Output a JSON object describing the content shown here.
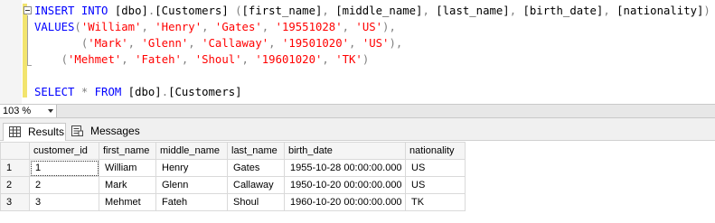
{
  "editor": {
    "lines": [
      {
        "tokens": [
          {
            "t": "INSERT",
            "c": "kw"
          },
          {
            "t": " ",
            "c": "ident"
          },
          {
            "t": "INTO",
            "c": "kw"
          },
          {
            "t": " [dbo]",
            "c": "ident"
          },
          {
            "t": ".",
            "c": "pun"
          },
          {
            "t": "[Customers]",
            "c": "ident"
          },
          {
            "t": " ",
            "c": "ident"
          },
          {
            "t": "(",
            "c": "pun"
          },
          {
            "t": "[first_name]",
            "c": "ident"
          },
          {
            "t": ", ",
            "c": "pun"
          },
          {
            "t": "[middle_name]",
            "c": "ident"
          },
          {
            "t": ", ",
            "c": "pun"
          },
          {
            "t": "[last_name]",
            "c": "ident"
          },
          {
            "t": ", ",
            "c": "pun"
          },
          {
            "t": "[birth_date]",
            "c": "ident"
          },
          {
            "t": ", ",
            "c": "pun"
          },
          {
            "t": "[nationality]",
            "c": "ident"
          },
          {
            "t": ")",
            "c": "pun"
          }
        ]
      },
      {
        "tokens": [
          {
            "t": "VALUES",
            "c": "kw"
          },
          {
            "t": "(",
            "c": "pun"
          },
          {
            "t": "'William'",
            "c": "str"
          },
          {
            "t": ", ",
            "c": "pun"
          },
          {
            "t": "'Henry'",
            "c": "str"
          },
          {
            "t": ", ",
            "c": "pun"
          },
          {
            "t": "'Gates'",
            "c": "str"
          },
          {
            "t": ", ",
            "c": "pun"
          },
          {
            "t": "'19551028'",
            "c": "str"
          },
          {
            "t": ", ",
            "c": "pun"
          },
          {
            "t": "'US'",
            "c": "str"
          },
          {
            "t": "),",
            "c": "pun"
          }
        ]
      },
      {
        "tokens": [
          {
            "t": "       ",
            "c": "ident"
          },
          {
            "t": "(",
            "c": "pun"
          },
          {
            "t": "'Mark'",
            "c": "str"
          },
          {
            "t": ", ",
            "c": "pun"
          },
          {
            "t": "'Glenn'",
            "c": "str"
          },
          {
            "t": ", ",
            "c": "pun"
          },
          {
            "t": "'Callaway'",
            "c": "str"
          },
          {
            "t": ", ",
            "c": "pun"
          },
          {
            "t": "'19501020'",
            "c": "str"
          },
          {
            "t": ", ",
            "c": "pun"
          },
          {
            "t": "'US'",
            "c": "str"
          },
          {
            "t": "),",
            "c": "pun"
          }
        ]
      },
      {
        "tokens": [
          {
            "t": "    ",
            "c": "ident"
          },
          {
            "t": "(",
            "c": "pun"
          },
          {
            "t": "'Mehmet'",
            "c": "str"
          },
          {
            "t": ", ",
            "c": "pun"
          },
          {
            "t": "'Fateh'",
            "c": "str"
          },
          {
            "t": ", ",
            "c": "pun"
          },
          {
            "t": "'Shoul'",
            "c": "str"
          },
          {
            "t": ", ",
            "c": "pun"
          },
          {
            "t": "'19601020'",
            "c": "str"
          },
          {
            "t": ", ",
            "c": "pun"
          },
          {
            "t": "'TK'",
            "c": "str"
          },
          {
            "t": ")",
            "c": "pun"
          }
        ]
      },
      {
        "tokens": []
      },
      {
        "tokens": [
          {
            "t": "SELECT",
            "c": "kw"
          },
          {
            "t": " ",
            "c": "ident"
          },
          {
            "t": "*",
            "c": "pun"
          },
          {
            "t": " ",
            "c": "ident"
          },
          {
            "t": "FROM",
            "c": "kw"
          },
          {
            "t": " [dbo]",
            "c": "ident"
          },
          {
            "t": ".",
            "c": "pun"
          },
          {
            "t": "[Customers]",
            "c": "ident"
          }
        ]
      }
    ]
  },
  "zoom": {
    "value": "103 %"
  },
  "tabs": [
    {
      "label": "Results",
      "icon": "grid-icon",
      "active": true
    },
    {
      "label": "Messages",
      "icon": "messages-icon",
      "active": false
    }
  ],
  "results": {
    "columns": [
      "customer_id",
      "first_name",
      "middle_name",
      "last_name",
      "birth_date",
      "nationality"
    ],
    "rows": [
      {
        "row_number": "1",
        "cells": [
          "1",
          "William",
          "Henry",
          "Gates",
          "1955-10-28 00:00:00.000",
          "US"
        ]
      },
      {
        "row_number": "2",
        "cells": [
          "2",
          "Mark",
          "Glenn",
          "Callaway",
          "1950-10-20 00:00:00.000",
          "US"
        ]
      },
      {
        "row_number": "3",
        "cells": [
          "3",
          "Mehmet",
          "Fateh",
          "Shoul",
          "1960-10-20 00:00:00.000",
          "TK"
        ]
      }
    ]
  },
  "colors": {
    "keyword": "#0000ff",
    "string": "#ff0000",
    "punctuation": "#808080",
    "change_bar": "#f2e46e"
  }
}
